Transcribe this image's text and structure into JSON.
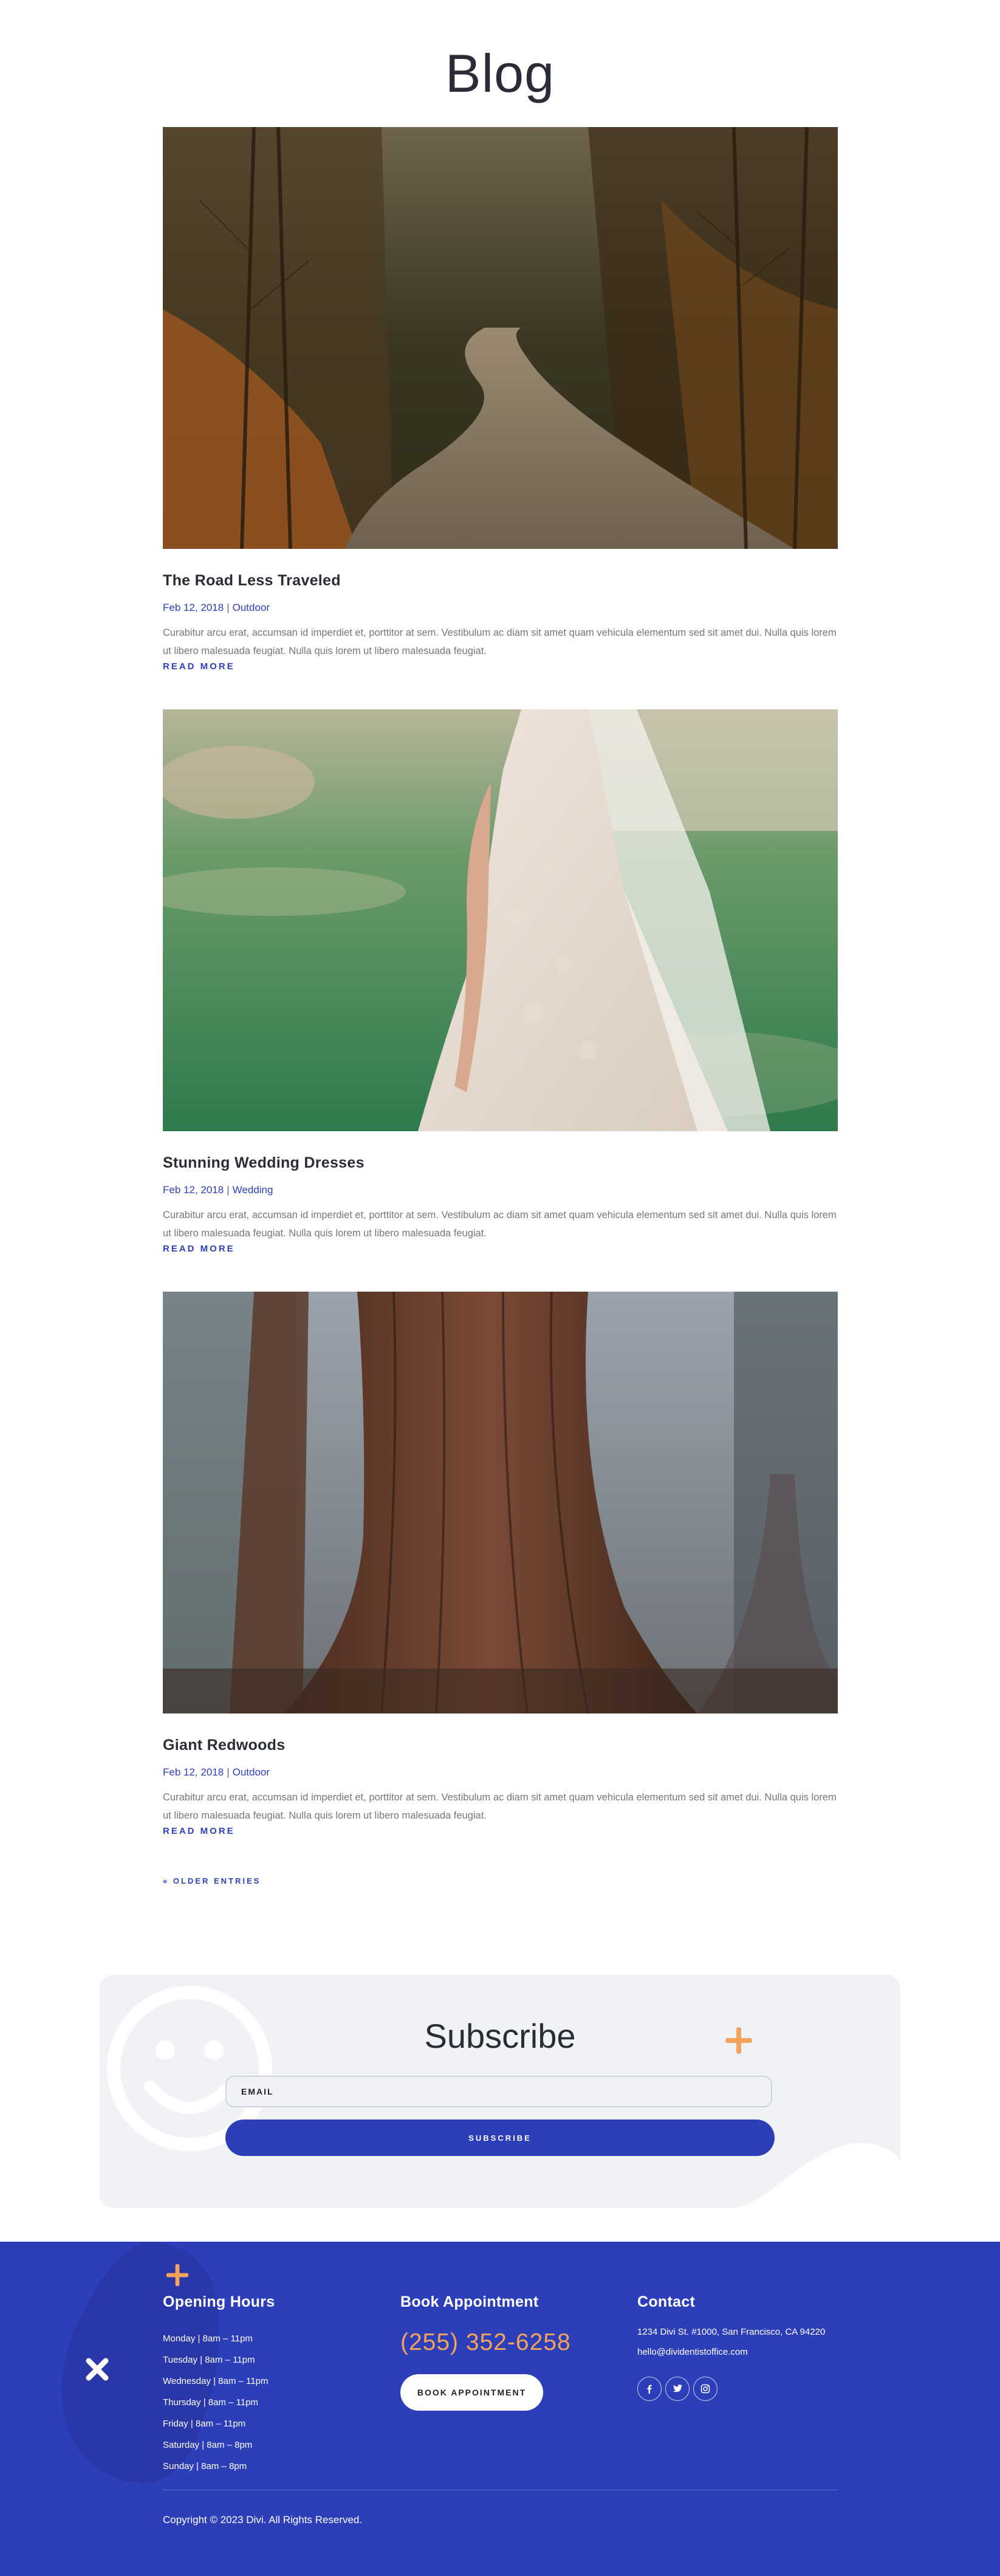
{
  "page": {
    "title": "Blog"
  },
  "posts": [
    {
      "title": "The Road Less Traveled",
      "date": "Feb 12, 2018",
      "separator": "|",
      "category": "Outdoor",
      "excerpt": "Curabitur arcu erat, accumsan id imperdiet et, porttitor at sem. Vestibulum ac diam sit amet quam vehicula elementum sed sit amet dui. Nulla quis lorem ut libero malesuada feugiat. Nulla quis lorem ut libero malesuada feugiat.",
      "read_more": "READ MORE"
    },
    {
      "title": "Stunning Wedding Dresses",
      "date": "Feb 12, 2018",
      "separator": "|",
      "category": "Wedding",
      "excerpt": "Curabitur arcu erat, accumsan id imperdiet et, porttitor at sem. Vestibulum ac diam sit amet quam vehicula elementum sed sit amet dui. Nulla quis lorem ut libero malesuada feugiat. Nulla quis lorem ut libero malesuada feugiat.",
      "read_more": "READ MORE"
    },
    {
      "title": "Giant Redwoods",
      "date": "Feb 12, 2018",
      "separator": "|",
      "category": "Outdoor",
      "excerpt": "Curabitur arcu erat, accumsan id imperdiet et, porttitor at sem. Vestibulum ac diam sit amet quam vehicula elementum sed sit amet dui. Nulla quis lorem ut libero malesuada feugiat. Nulla quis lorem ut libero malesuada feugiat.",
      "read_more": "READ MORE"
    }
  ],
  "pagination": {
    "older_entries": "« OLDER ENTRIES"
  },
  "subscribe": {
    "title": "Subscribe",
    "email_placeholder": "EMAIL",
    "button_label": "SUBSCRIBE"
  },
  "footer": {
    "hours": {
      "heading": "Opening Hours",
      "items": [
        "Monday | 8am – 11pm",
        "Tuesday | 8am – 11pm",
        "Wednesday | 8am – 11pm",
        "Thursday | 8am – 11pm",
        "Friday | 8am – 11pm",
        "Saturday | 8am – 8pm",
        "Sunday | 8am – 8pm"
      ]
    },
    "appointment": {
      "heading": "Book Appointment",
      "phone": "(255) 352-6258",
      "button_label": "BOOK APPOINTMENT"
    },
    "contact": {
      "heading": "Contact",
      "address": "1234 Divi St. #1000, San Francisco, CA 94220",
      "email": "hello@dividentistoffice.com",
      "social": [
        "facebook-icon",
        "twitter-icon",
        "instagram-icon"
      ]
    },
    "copyright": "Copyright © 2023 Divi. All Rights Reserved."
  },
  "colors": {
    "accent_blue": "#2d3fb8",
    "accent_orange": "#f4a35c",
    "card_bg": "#f0f2f6",
    "text_dark": "#2b2d36",
    "text_muted": "#777777"
  }
}
